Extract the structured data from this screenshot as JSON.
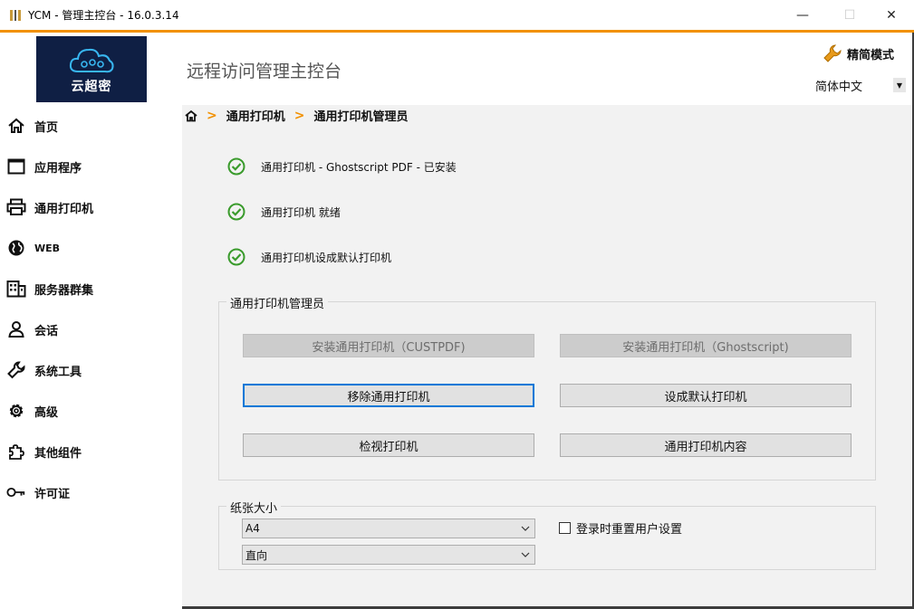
{
  "window": {
    "title": "YCM - 管理主控台 - 16.0.3.14",
    "minimize": "—",
    "maximize": "☐",
    "close": "✕"
  },
  "header": {
    "logo_text": "云超密",
    "app_title": "远程访问管理主控台",
    "mode_label": "精简模式",
    "language": "简体中文"
  },
  "sidebar": {
    "items": [
      {
        "label": "首页",
        "icon": "home-icon"
      },
      {
        "label": "应用程序",
        "icon": "window-icon"
      },
      {
        "label": "通用打印机",
        "icon": "printer-icon"
      },
      {
        "label": "WEB",
        "icon": "globe-icon"
      },
      {
        "label": "服务器群集",
        "icon": "building-icon"
      },
      {
        "label": "会话",
        "icon": "user-icon"
      },
      {
        "label": "系统工具",
        "icon": "wrench-icon"
      },
      {
        "label": "高级",
        "icon": "gear-icon"
      },
      {
        "label": "其他组件",
        "icon": "puzzle-icon"
      },
      {
        "label": "许可证",
        "icon": "key-icon"
      }
    ]
  },
  "breadcrumb": {
    "items": [
      "通用打印机",
      "通用打印机管理员"
    ],
    "separator": ">"
  },
  "status": {
    "items": [
      "通用打印机 - Ghostscript PDF - 已安装",
      "通用打印机 就绪",
      "通用打印机设成默认打印机"
    ]
  },
  "manager_group": {
    "title": "通用打印机管理员",
    "buttons": {
      "install_custpdf": "安装通用打印机（CUSTPDF)",
      "install_ghostscript": "安装通用打印机（Ghostscript)",
      "remove": "移除通用打印机",
      "set_default": "设成默认打印机",
      "view": "检视打印机",
      "content": "通用打印机内容"
    }
  },
  "paper_group": {
    "title": "纸张大小",
    "size_value": "A4",
    "orientation_value": "直向",
    "reset_checkbox_label": "登录时重置用户设置",
    "reset_checked": false
  },
  "colors": {
    "accent": "#f29100",
    "logo_bg": "#0f1f44",
    "check_green": "#3a9b2c",
    "focus_blue": "#0078d7"
  }
}
